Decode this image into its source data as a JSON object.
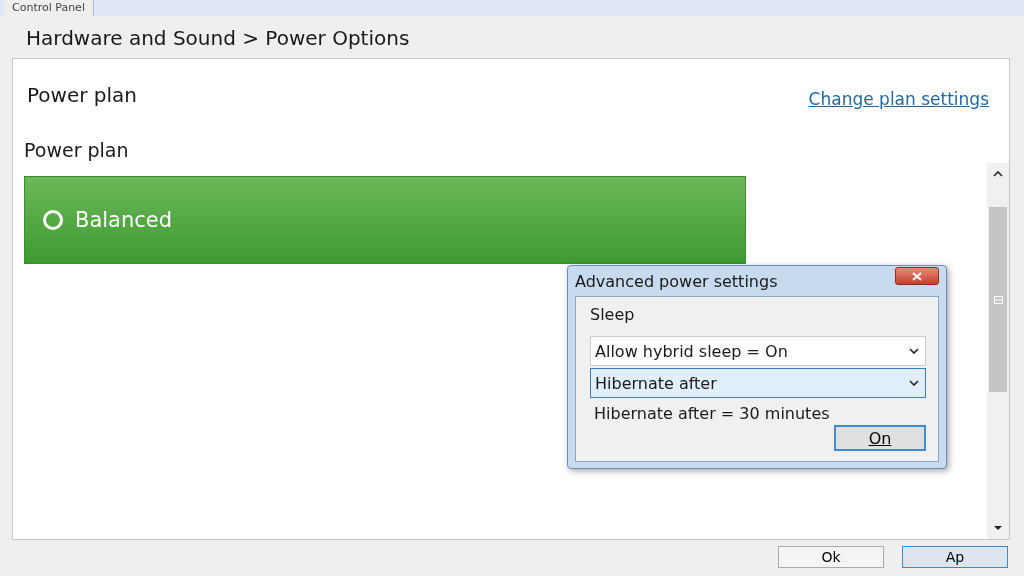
{
  "tab": {
    "label": "Control Panel",
    "selected": true
  },
  "breadcrumb": "Hardware and Sound > Power Options",
  "header": {
    "title": "Power plan",
    "link": "Change plan settings"
  },
  "plan_list": {
    "label": "Power plan",
    "plans": [
      {
        "name": "Balanced",
        "selected": true
      }
    ]
  },
  "dialog": {
    "title": "Advanced power settings",
    "section": "Sleep",
    "dropdowns": [
      {
        "value": "Allow hybrid sleep = On",
        "focused": false
      },
      {
        "value": "Hibernate after",
        "focused": true
      }
    ],
    "status": "Hibernate after = 30 minutes",
    "button": "On"
  },
  "buttons": [
    "Ok",
    "Ap"
  ]
}
